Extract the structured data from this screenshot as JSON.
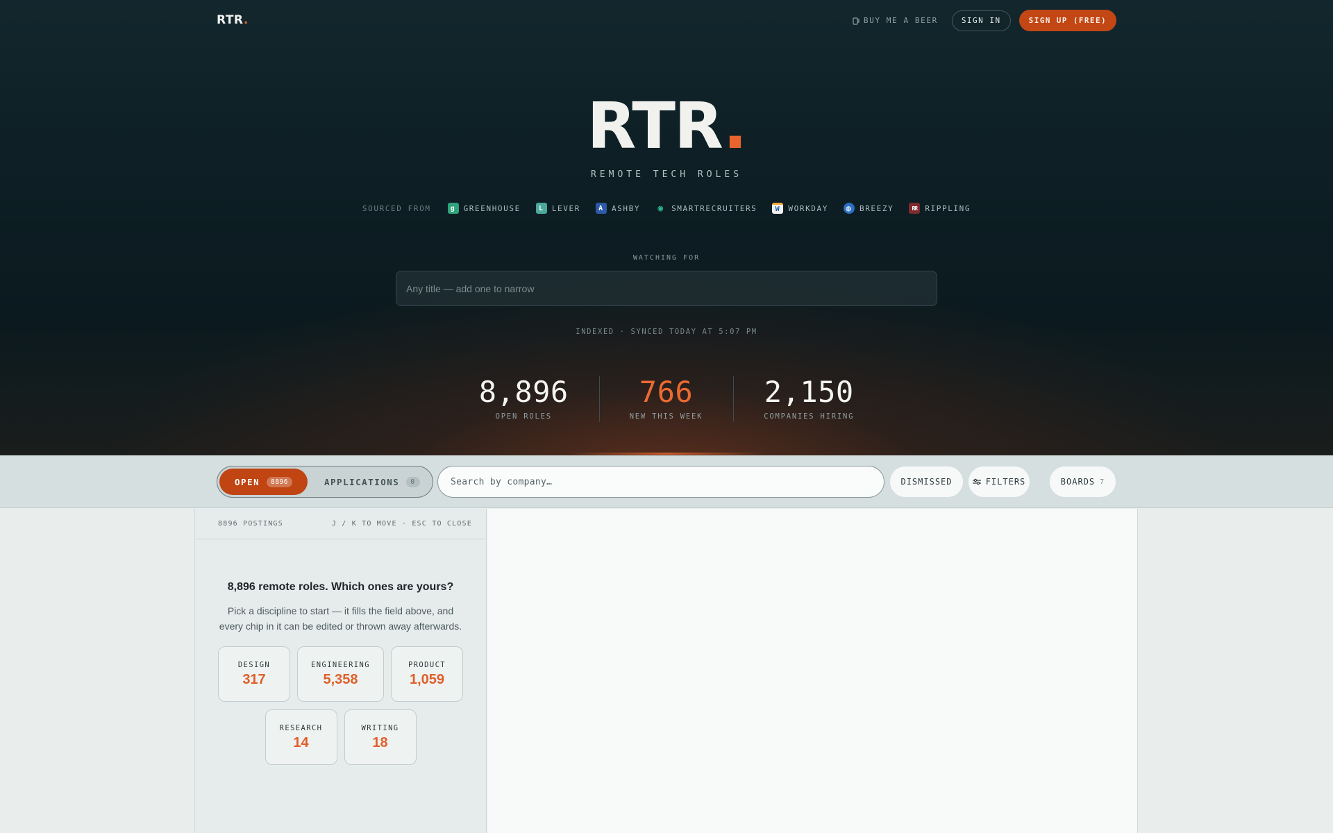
{
  "header": {
    "logo": "RTR",
    "logo_dot": ".",
    "beer_label": "BUY ME A BEER",
    "signin_label": "SIGN IN",
    "signup_label": "SIGN UP (FREE)"
  },
  "hero": {
    "brand": "RTR",
    "brand_dot": ".",
    "tagline": "REMOTE TECH ROLES",
    "sourced_label": "SOURCED FROM",
    "sources": [
      {
        "name": "GREENHOUSE",
        "icon": "greenhouse-icon",
        "color": "#2fa37c",
        "glyph": "g"
      },
      {
        "name": "LEVER",
        "icon": "lever-icon",
        "color": "#4aa89c",
        "glyph": "L"
      },
      {
        "name": "ASHBY",
        "icon": "ashby-icon",
        "color": "#2d5aa8",
        "glyph": "A"
      },
      {
        "name": "SMARTRECRUITERS",
        "icon": "smartrecruiters-icon",
        "color": "#2f9d7e",
        "glyph": "◉"
      },
      {
        "name": "WORKDAY",
        "icon": "workday-icon",
        "color": "#f0f0f0",
        "glyph": "W"
      },
      {
        "name": "BREEZY",
        "icon": "breezy-icon",
        "color": "#2b6fc2",
        "glyph": "◍"
      },
      {
        "name": "RIPPLING",
        "icon": "rippling-icon",
        "color": "#7d2a2e",
        "glyph": "RR"
      }
    ],
    "watching_label": "WATCHING FOR",
    "title_placeholder": "Any title — add one to narrow",
    "sync_text": "INDEXED · SYNCED TODAY AT 5:07 PM",
    "stats": [
      {
        "value": "8,896",
        "label": "OPEN ROLES"
      },
      {
        "value": "766",
        "label": "NEW THIS WEEK"
      },
      {
        "value": "2,150",
        "label": "COMPANIES HIRING"
      }
    ]
  },
  "toolbar": {
    "open_label": "OPEN",
    "open_count": "8896",
    "applications_label": "APPLICATIONS",
    "applications_count": "0",
    "search_placeholder": "Search by company…",
    "dismissed_label": "DISMISSED",
    "filters_label": "FILTERS",
    "boards_label": "BOARDS",
    "boards_count": "7"
  },
  "list": {
    "postings_label": "8896 POSTINGS",
    "shortcut_hint": "J / K TO MOVE · ESC TO CLOSE",
    "onboard_title": "8,896 remote roles. Which ones are yours?",
    "onboard_desc": "Pick a discipline to start — it fills the field above, and every chip in it can be edited or thrown away afterwards.",
    "disciplines": [
      {
        "name": "DESIGN",
        "count": "317"
      },
      {
        "name": "ENGINEERING",
        "count": "5,358"
      },
      {
        "name": "PRODUCT",
        "count": "1,059"
      },
      {
        "name": "RESEARCH",
        "count": "14"
      },
      {
        "name": "WRITING",
        "count": "18"
      }
    ]
  },
  "colors": {
    "accent": "#c24714",
    "accent_bright": "#eb6a32",
    "hero_bg": "#0d1e24"
  }
}
